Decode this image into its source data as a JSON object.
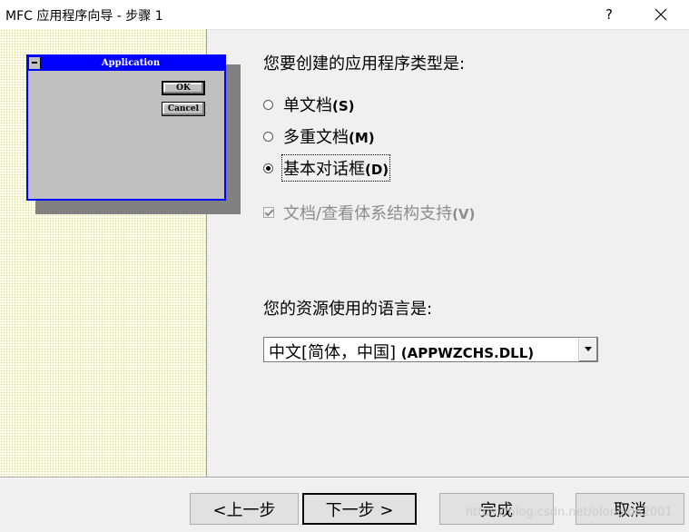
{
  "window": {
    "title": "MFC 应用程序向导 - 步骤 1",
    "help_glyph": "?",
    "close_icon": "close-icon"
  },
  "preview": {
    "title": "Application",
    "ok_label": "OK",
    "cancel_label": "Cancel"
  },
  "app_type": {
    "prompt": "您要创建的应用程序类型是:",
    "options": [
      {
        "label": "单文档",
        "key": "(S)",
        "checked": false
      },
      {
        "label": "多重文档",
        "key": "(M)",
        "checked": false
      },
      {
        "label": "基本对话框",
        "key": "(D)",
        "checked": true
      }
    ]
  },
  "docview": {
    "label": "文档/查看体系结构支持",
    "key": "(V)",
    "checked": true,
    "enabled": false
  },
  "language": {
    "prompt": "您的资源使用的语言是:",
    "selected_cn": "中文[简体，中国]",
    "selected_dll": "(APPWZCHS.DLL)"
  },
  "buttons": {
    "back": "<上一步",
    "next": "下一步 >",
    "finish": "完成",
    "cancel": "取消"
  },
  "watermark": "https://blog.csdn.net/olonoldo2001"
}
